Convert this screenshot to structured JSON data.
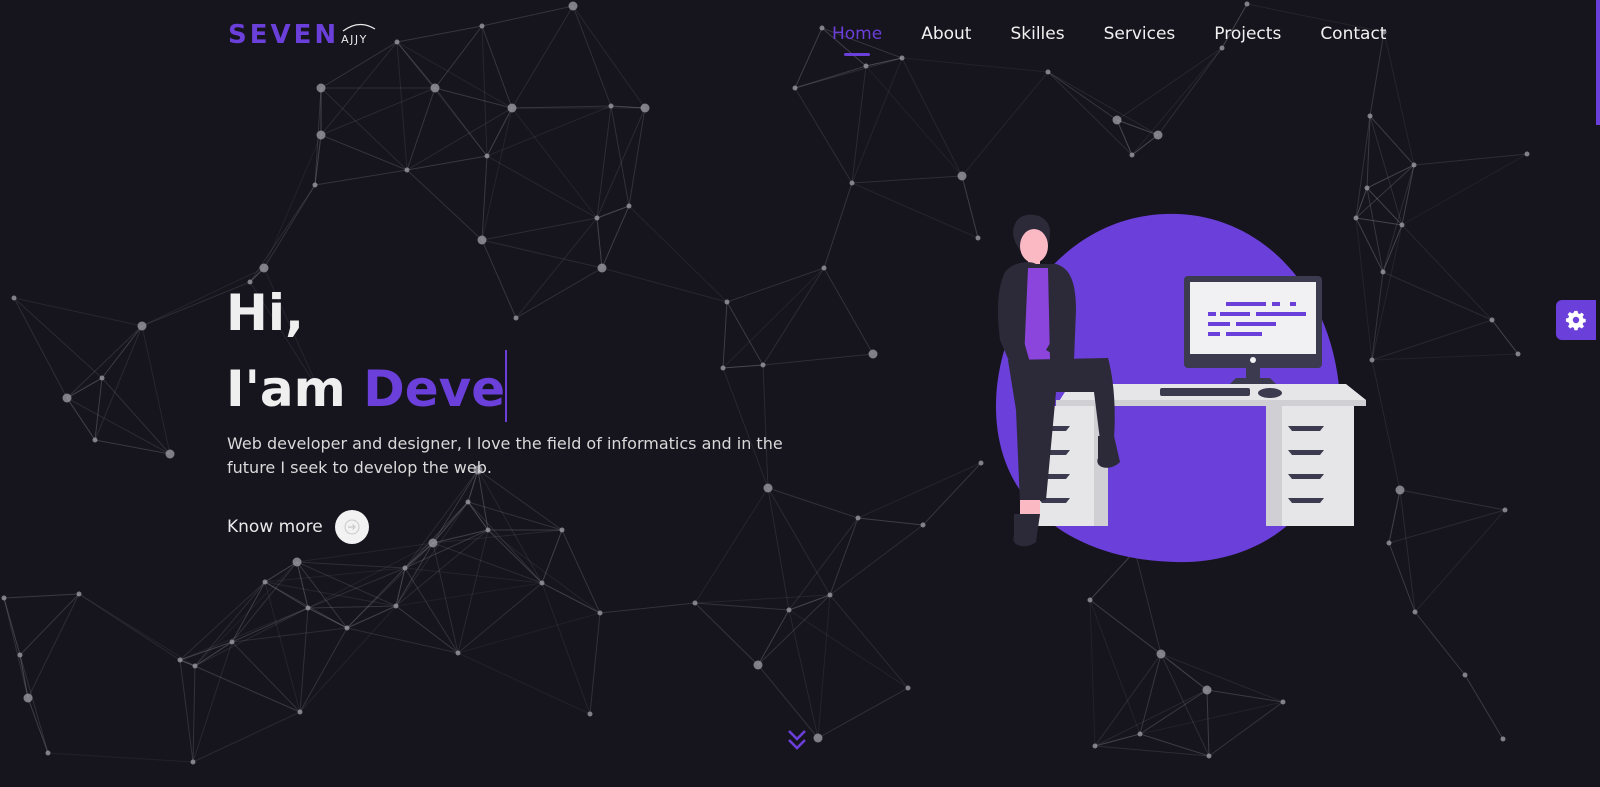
{
  "logo": {
    "main": "SEVEN",
    "sub": "AJJY"
  },
  "nav": {
    "items": [
      {
        "label": "Home",
        "active": true
      },
      {
        "label": "About",
        "active": false
      },
      {
        "label": "Skilles",
        "active": false
      },
      {
        "label": "Services",
        "active": false
      },
      {
        "label": "Projects",
        "active": false
      },
      {
        "label": "Contact",
        "active": false
      }
    ]
  },
  "hero": {
    "greeting": "Hi,",
    "intro": "I'am",
    "typed_text": "Deve",
    "description": "Web developer and designer, I love the field of informatics and in the future I seek to develop the web.",
    "cta_label": "Know more"
  },
  "icons": {
    "cta": "arrow-right-icon",
    "settings": "gear-icon",
    "scroll": "double-chevron-down-icon"
  },
  "colors": {
    "accent": "#6b3fd9",
    "background": "#16141d",
    "text": "#f1f1f1"
  }
}
